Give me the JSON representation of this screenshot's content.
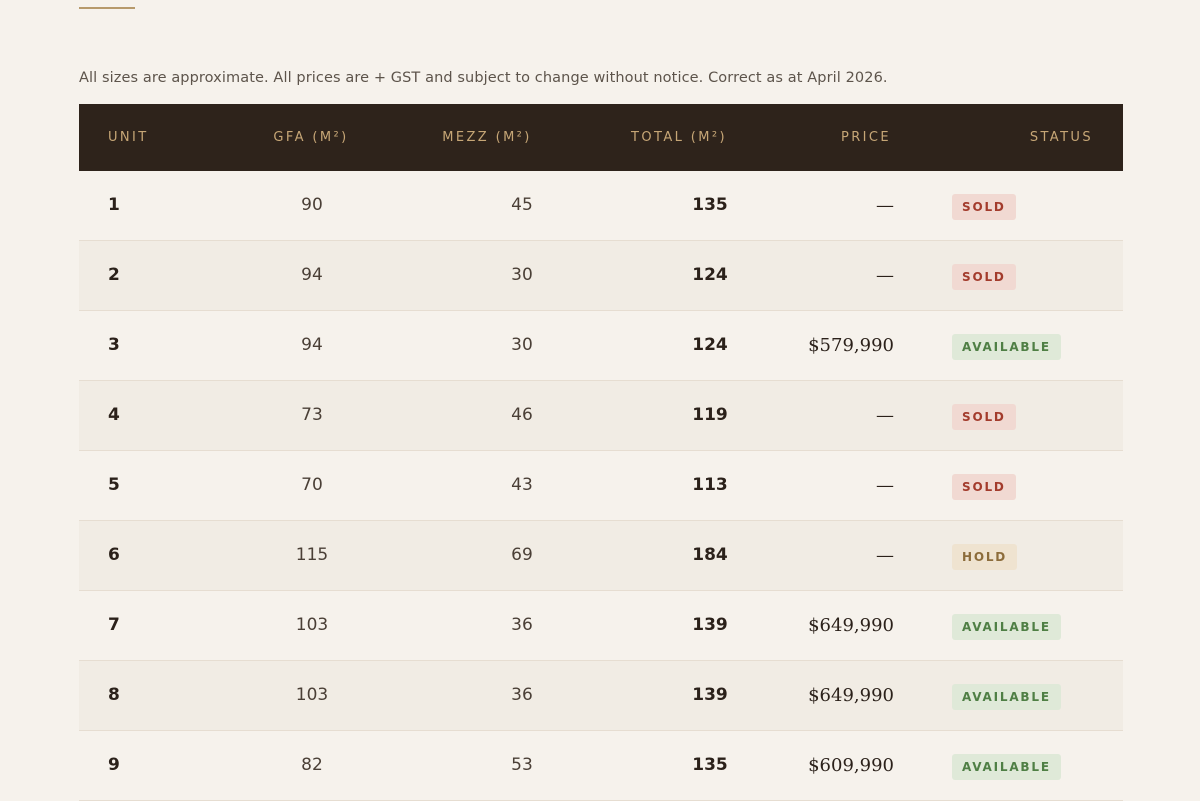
{
  "disclaimer": "All sizes are approximate. All prices are + GST and subject to change without notice. Correct as at April 2026.",
  "table": {
    "columns": [
      "UNIT",
      "GFA (M²)",
      "MEZZ (M²)",
      "TOTAL (M²)",
      "PRICE",
      "STATUS"
    ],
    "rows": [
      {
        "unit": "1",
        "gfa": "90",
        "mezz": "45",
        "total": "135",
        "price": "—",
        "status": "SOLD"
      },
      {
        "unit": "2",
        "gfa": "94",
        "mezz": "30",
        "total": "124",
        "price": "—",
        "status": "SOLD"
      },
      {
        "unit": "3",
        "gfa": "94",
        "mezz": "30",
        "total": "124",
        "price": "$579,990",
        "status": "AVAILABLE"
      },
      {
        "unit": "4",
        "gfa": "73",
        "mezz": "46",
        "total": "119",
        "price": "—",
        "status": "SOLD"
      },
      {
        "unit": "5",
        "gfa": "70",
        "mezz": "43",
        "total": "113",
        "price": "—",
        "status": "SOLD"
      },
      {
        "unit": "6",
        "gfa": "115",
        "mezz": "69",
        "total": "184",
        "price": "—",
        "status": "HOLD"
      },
      {
        "unit": "7",
        "gfa": "103",
        "mezz": "36",
        "total": "139",
        "price": "$649,990",
        "status": "AVAILABLE"
      },
      {
        "unit": "8",
        "gfa": "103",
        "mezz": "36",
        "total": "139",
        "price": "$649,990",
        "status": "AVAILABLE"
      },
      {
        "unit": "9",
        "gfa": "82",
        "mezz": "53",
        "total": "135",
        "price": "$609,990",
        "status": "AVAILABLE"
      }
    ]
  },
  "status_colors": {
    "SOLD": "#a33b2c",
    "AVAILABLE": "#4f7f45",
    "HOLD": "#8c6c3b"
  },
  "accent_color": "#b79a6c",
  "header_bg": "#2e231b"
}
